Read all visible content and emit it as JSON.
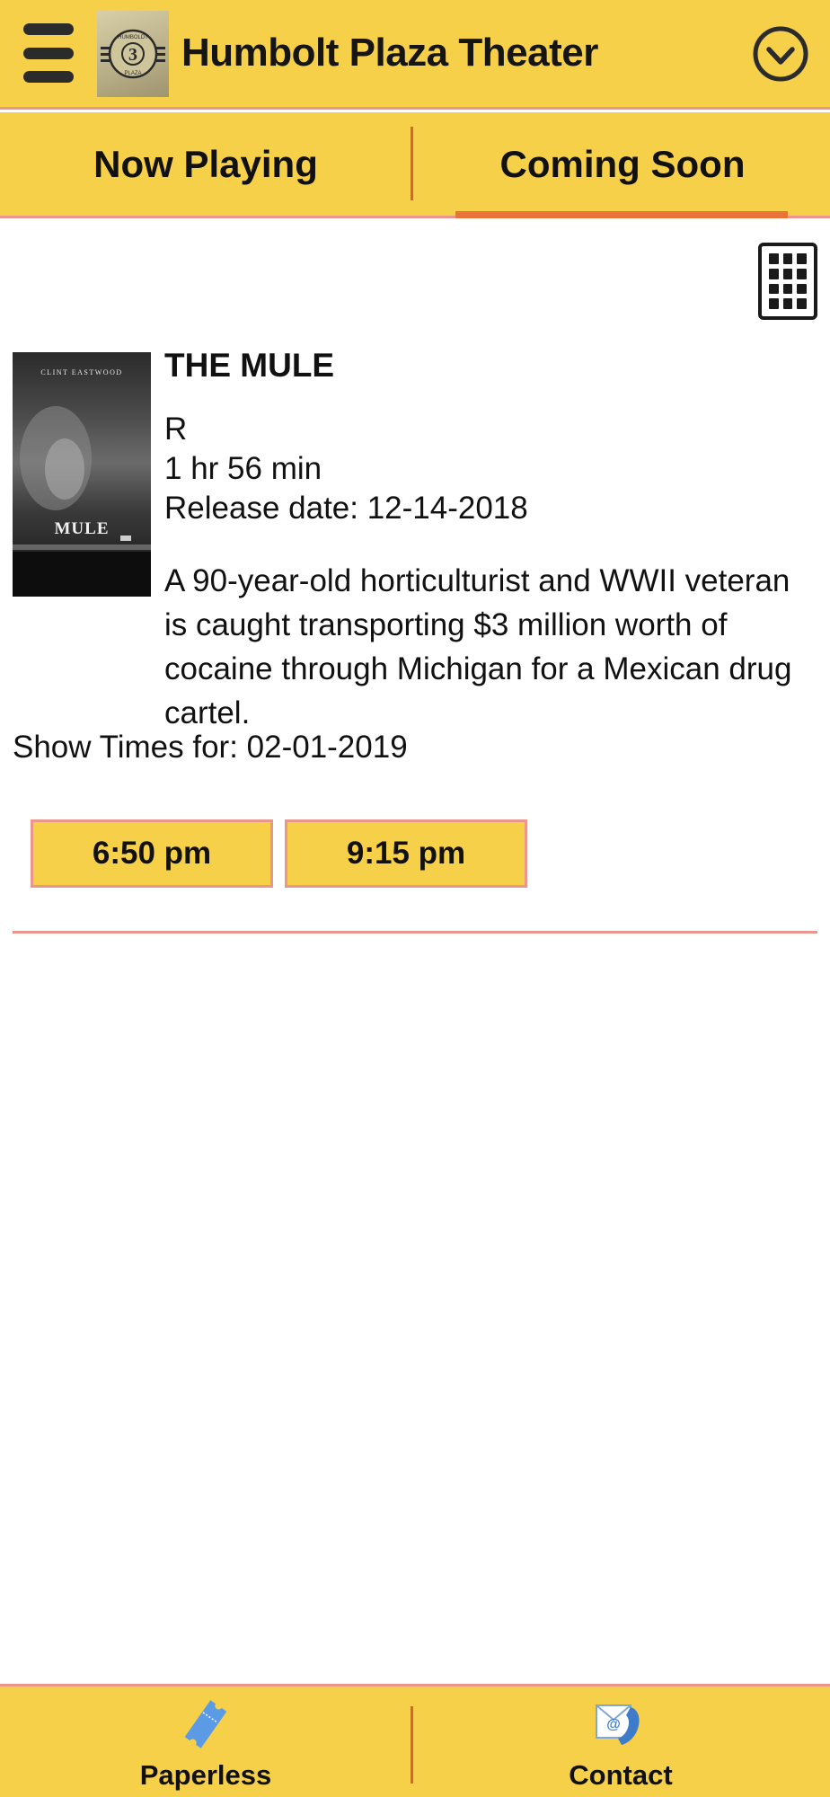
{
  "header": {
    "title": "Humbolt Plaza Theater",
    "logo_text_top": "HUMBOLDT",
    "logo_number": "3",
    "logo_text_bottom": "PLAZA"
  },
  "tabs": [
    {
      "label": "Now Playing",
      "active": false
    },
    {
      "label": "Coming Soon",
      "active": true
    }
  ],
  "movie": {
    "poster": {
      "actor": "CLINT EASTWOOD",
      "title": "MULE",
      "title_small": "THE"
    },
    "title": "THE MULE",
    "rating": "R",
    "runtime": "1 hr 56 min",
    "release": "Release date: 12-14-2018",
    "description": "A 90-year-old horticulturist and WWII veteran is caught transporting $3 million worth of cocaine through Michigan for a Mexican drug cartel.",
    "showtimes_label": "Show Times for: 02-01-2019",
    "showtimes": [
      "6:50 pm",
      "9:15 pm"
    ]
  },
  "bottom_nav": {
    "paperless": "Paperless",
    "contact": "Contact"
  },
  "colors": {
    "bar": "#F7D04A",
    "accent_line": "#E9968F",
    "tab_underline": "#E8743A",
    "ticket_icon": "#5B9BE6"
  },
  "icons": [
    "menu-icon",
    "chevron-down-circle-icon",
    "grid-view-icon",
    "ticket-icon",
    "contact-mail-phone-icon"
  ]
}
